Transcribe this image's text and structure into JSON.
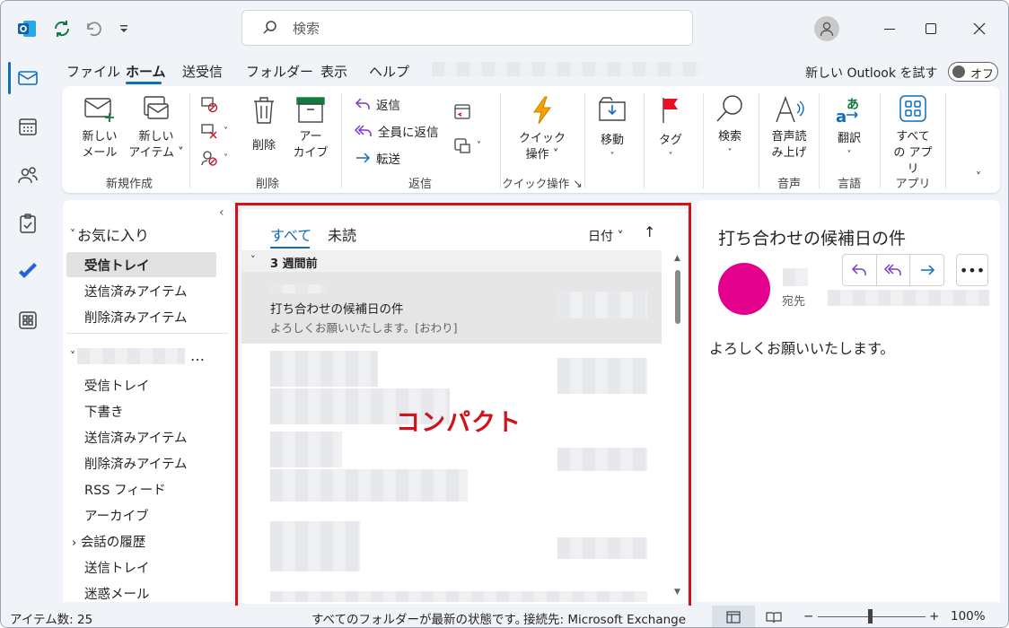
{
  "titlebar": {
    "search_placeholder": "検索"
  },
  "menu": {
    "tabs": [
      "ファイル",
      "ホーム",
      "送受信",
      "フォルダー",
      "表示",
      "ヘルプ"
    ],
    "new_outlook_label": "新しい Outlook を試す",
    "toggle_label": "オフ"
  },
  "ribbon": {
    "new_mail": [
      "新しい",
      "メール"
    ],
    "new_item": [
      "新しい",
      "アイテム"
    ],
    "group_new": "新規作成",
    "delete": "削除",
    "archive": [
      "アー",
      "カイブ"
    ],
    "group_delete": "削除",
    "reply": "返信",
    "reply_all": "全員に返信",
    "forward": "転送",
    "group_respond": "返信",
    "quick_steps": [
      "クイック",
      "操作"
    ],
    "group_quick": "クイック操作",
    "move": "移動",
    "tags": "タグ",
    "find": "検索",
    "read_aloud": [
      "音声読",
      "み上げ"
    ],
    "group_voice": "音声",
    "translate": "翻訳",
    "group_language": "言語",
    "all_apps": [
      "すべて",
      "の アプリ"
    ],
    "group_apps": "アプリ"
  },
  "folders": {
    "favorites_header": "お気に入り",
    "favorites": [
      "受信トレイ",
      "送信済みアイテム",
      "削除済みアイテム"
    ],
    "account_items": [
      "受信トレイ",
      "下書き",
      "送信済みアイテム",
      "削除済みアイテム",
      "RSS フィード",
      "アーカイブ"
    ],
    "conversation_history": "会話の履歴",
    "more_items": [
      "送信トレイ",
      "迷惑メール"
    ]
  },
  "list": {
    "tab_all": "すべて",
    "tab_unread": "未読",
    "sort_label": "日付",
    "group_header": "3 週間前",
    "selected_message": {
      "subject": "打ち合わせの候補日の件",
      "preview": "よろしくお願いいたします。[おわり]"
    },
    "annotation": "コンパクト"
  },
  "reading": {
    "subject": "打ち合わせの候補日の件",
    "to_label": "宛先",
    "body": "よろしくお願いいたします。"
  },
  "status": {
    "item_count": "アイテム数: 25",
    "sync": "すべてのフォルダーが最新の状態です。",
    "connection": "接続先: Microsoft Exchange",
    "zoom": "100%"
  },
  "colors": {
    "accent": "#0f6cbd",
    "annotation_red": "#d0121b",
    "avatar_pink": "#e3008c"
  }
}
